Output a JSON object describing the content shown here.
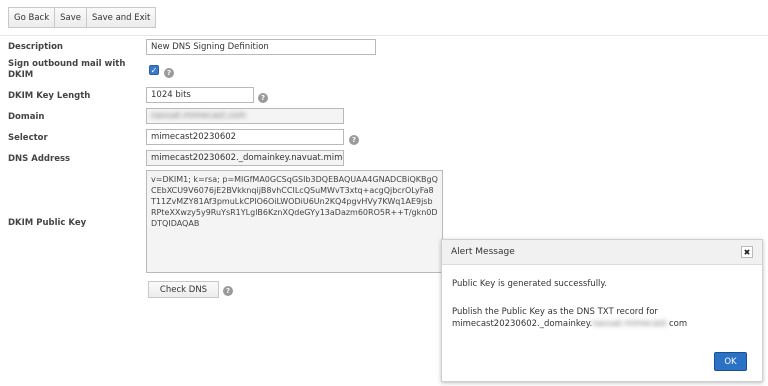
{
  "toolbar": {
    "go_back": "Go Back",
    "save": "Save",
    "save_exit": "Save and Exit"
  },
  "form": {
    "description_label": "Description",
    "description_value": "New DNS Signing Definition",
    "sign_label": "Sign outbound mail with DKIM",
    "sign_checked": true,
    "key_length_label": "DKIM Key Length",
    "key_length_value": "1024 bits",
    "domain_label": "Domain",
    "domain_value": "navuat.mimecast.com",
    "selector_label": "Selector",
    "selector_value": "mimecast20230602",
    "dns_address_label": "DNS Address",
    "dns_address_value": "mimecast20230602._domainkey.navuat.mime",
    "public_key_label": "DKIM Public Key",
    "public_key_value": "v=DKIM1; k=rsa; p=MIGfMA0GCSqGSIb3DQEBAQUAA4GNADCBiQKBgQCEbXCU9V6076jE2BVkknqijB8vhCCILcQSuMWvT3xtq+acgQjbcrOLyFa8T11ZvMZY81Af3pmuLkCPIO6OiLWODiU6Un2KQ4pgvHVy7KWq1AE9jsbRPteXXwzy5y9RuYsR1YLglB6KznXQdeGYy13aDazm60RO5R++T/gkn0DDTQIDAQAB",
    "check_dns": "Check DNS",
    "help_glyph": "?"
  },
  "modal": {
    "title": "Alert Message",
    "close_glyph": "✖",
    "message1": "Public Key is generated successfully.",
    "message2_line1": "Publish the Public Key as the DNS TXT record for",
    "message2_prefix": "mimecast20230602._domainkey.",
    "message2_blurred": "navuat.mimecast.",
    "message2_suffix": "com",
    "ok": "OK"
  },
  "colors": {
    "accent": "#2a72c6",
    "checkbox": "#3a78c8"
  }
}
